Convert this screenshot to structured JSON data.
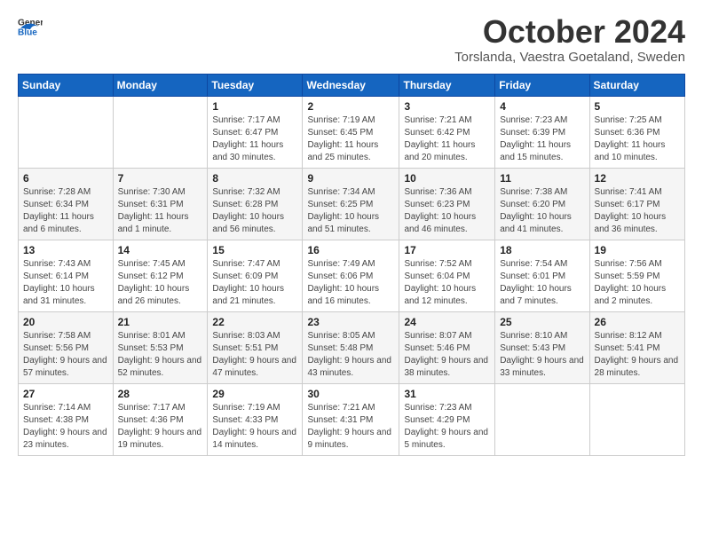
{
  "header": {
    "logo_general": "General",
    "logo_blue": "Blue",
    "title": "October 2024",
    "subtitle": "Torslanda, Vaestra Goetaland, Sweden"
  },
  "weekdays": [
    "Sunday",
    "Monday",
    "Tuesday",
    "Wednesday",
    "Thursday",
    "Friday",
    "Saturday"
  ],
  "weeks": [
    [
      {
        "day": "",
        "info": ""
      },
      {
        "day": "",
        "info": ""
      },
      {
        "day": "1",
        "info": "Sunrise: 7:17 AM\nSunset: 6:47 PM\nDaylight: 11 hours and 30 minutes."
      },
      {
        "day": "2",
        "info": "Sunrise: 7:19 AM\nSunset: 6:45 PM\nDaylight: 11 hours and 25 minutes."
      },
      {
        "day": "3",
        "info": "Sunrise: 7:21 AM\nSunset: 6:42 PM\nDaylight: 11 hours and 20 minutes."
      },
      {
        "day": "4",
        "info": "Sunrise: 7:23 AM\nSunset: 6:39 PM\nDaylight: 11 hours and 15 minutes."
      },
      {
        "day": "5",
        "info": "Sunrise: 7:25 AM\nSunset: 6:36 PM\nDaylight: 11 hours and 10 minutes."
      }
    ],
    [
      {
        "day": "6",
        "info": "Sunrise: 7:28 AM\nSunset: 6:34 PM\nDaylight: 11 hours and 6 minutes."
      },
      {
        "day": "7",
        "info": "Sunrise: 7:30 AM\nSunset: 6:31 PM\nDaylight: 11 hours and 1 minute."
      },
      {
        "day": "8",
        "info": "Sunrise: 7:32 AM\nSunset: 6:28 PM\nDaylight: 10 hours and 56 minutes."
      },
      {
        "day": "9",
        "info": "Sunrise: 7:34 AM\nSunset: 6:25 PM\nDaylight: 10 hours and 51 minutes."
      },
      {
        "day": "10",
        "info": "Sunrise: 7:36 AM\nSunset: 6:23 PM\nDaylight: 10 hours and 46 minutes."
      },
      {
        "day": "11",
        "info": "Sunrise: 7:38 AM\nSunset: 6:20 PM\nDaylight: 10 hours and 41 minutes."
      },
      {
        "day": "12",
        "info": "Sunrise: 7:41 AM\nSunset: 6:17 PM\nDaylight: 10 hours and 36 minutes."
      }
    ],
    [
      {
        "day": "13",
        "info": "Sunrise: 7:43 AM\nSunset: 6:14 PM\nDaylight: 10 hours and 31 minutes."
      },
      {
        "day": "14",
        "info": "Sunrise: 7:45 AM\nSunset: 6:12 PM\nDaylight: 10 hours and 26 minutes."
      },
      {
        "day": "15",
        "info": "Sunrise: 7:47 AM\nSunset: 6:09 PM\nDaylight: 10 hours and 21 minutes."
      },
      {
        "day": "16",
        "info": "Sunrise: 7:49 AM\nSunset: 6:06 PM\nDaylight: 10 hours and 16 minutes."
      },
      {
        "day": "17",
        "info": "Sunrise: 7:52 AM\nSunset: 6:04 PM\nDaylight: 10 hours and 12 minutes."
      },
      {
        "day": "18",
        "info": "Sunrise: 7:54 AM\nSunset: 6:01 PM\nDaylight: 10 hours and 7 minutes."
      },
      {
        "day": "19",
        "info": "Sunrise: 7:56 AM\nSunset: 5:59 PM\nDaylight: 10 hours and 2 minutes."
      }
    ],
    [
      {
        "day": "20",
        "info": "Sunrise: 7:58 AM\nSunset: 5:56 PM\nDaylight: 9 hours and 57 minutes."
      },
      {
        "day": "21",
        "info": "Sunrise: 8:01 AM\nSunset: 5:53 PM\nDaylight: 9 hours and 52 minutes."
      },
      {
        "day": "22",
        "info": "Sunrise: 8:03 AM\nSunset: 5:51 PM\nDaylight: 9 hours and 47 minutes."
      },
      {
        "day": "23",
        "info": "Sunrise: 8:05 AM\nSunset: 5:48 PM\nDaylight: 9 hours and 43 minutes."
      },
      {
        "day": "24",
        "info": "Sunrise: 8:07 AM\nSunset: 5:46 PM\nDaylight: 9 hours and 38 minutes."
      },
      {
        "day": "25",
        "info": "Sunrise: 8:10 AM\nSunset: 5:43 PM\nDaylight: 9 hours and 33 minutes."
      },
      {
        "day": "26",
        "info": "Sunrise: 8:12 AM\nSunset: 5:41 PM\nDaylight: 9 hours and 28 minutes."
      }
    ],
    [
      {
        "day": "27",
        "info": "Sunrise: 7:14 AM\nSunset: 4:38 PM\nDaylight: 9 hours and 23 minutes."
      },
      {
        "day": "28",
        "info": "Sunrise: 7:17 AM\nSunset: 4:36 PM\nDaylight: 9 hours and 19 minutes."
      },
      {
        "day": "29",
        "info": "Sunrise: 7:19 AM\nSunset: 4:33 PM\nDaylight: 9 hours and 14 minutes."
      },
      {
        "day": "30",
        "info": "Sunrise: 7:21 AM\nSunset: 4:31 PM\nDaylight: 9 hours and 9 minutes."
      },
      {
        "day": "31",
        "info": "Sunrise: 7:23 AM\nSunset: 4:29 PM\nDaylight: 9 hours and 5 minutes."
      },
      {
        "day": "",
        "info": ""
      },
      {
        "day": "",
        "info": ""
      }
    ]
  ]
}
